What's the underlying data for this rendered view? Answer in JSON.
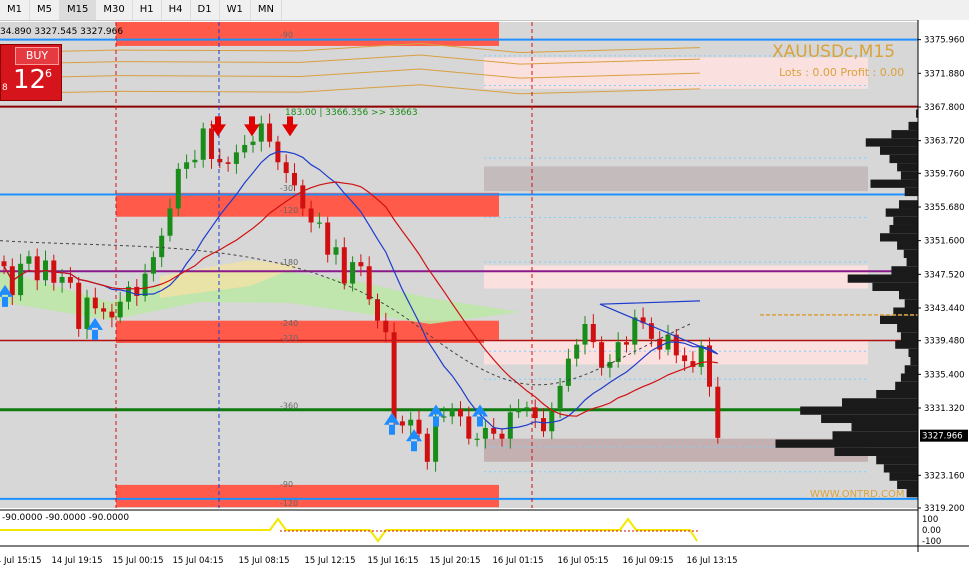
{
  "timeframes": [
    "M1",
    "M5",
    "M15",
    "M30",
    "H1",
    "H4",
    "D1",
    "W1",
    "MN"
  ],
  "selected_timeframe": "M15",
  "symbol_title": "XAUUSDc,M15",
  "lots_profit": "Lots : 0.00  Profit : 0.00",
  "watermark": "WWW.ONTRD.COM",
  "ohlc_line": "34.890 3327.545 3327.966",
  "buy_panel": {
    "label": "BUY",
    "price_small": "8",
    "price_big": "12",
    "price_sup": "6"
  },
  "indicator_values": "-90.0000 -90.0000 -90.0000",
  "level_label_183": "183.00 | 3366.356  >> 33663",
  "current_price_label": "3327.966",
  "colors": {
    "background": "#ffffff",
    "plot_bg": "#d7d7d7",
    "bull": "#1a8c1a",
    "bear": "#d01010",
    "zone_red": "#ff5a4a",
    "blue_line": "#1e90ff",
    "ma_blue": "#1e3ccc",
    "ma_red": "#d01010",
    "gold_text": "#dba23a",
    "profile": "#1a1a1a"
  },
  "chart_data": {
    "type": "candlestick",
    "symbol": "XAUUSDc",
    "timeframe": "M15",
    "ylim": [
      3319.2,
      3378.1
    ],
    "y_ticks": [
      "3375.960",
      "3371.880",
      "3367.800",
      "3363.720",
      "3359.760",
      "3355.680",
      "3351.600",
      "3347.520",
      "3343.440",
      "3339.480",
      "3335.400",
      "3331.320",
      "3327.966",
      "3323.160",
      "3319.200"
    ],
    "x_labels": [
      "14 Jul 15:15",
      "14 Jul 19:15",
      "15 Jul 00:15",
      "15 Jul 04:15",
      "15 Jul 08:15",
      "15 Jul 12:15",
      "15 Jul 16:15",
      "15 Jul 20:15",
      "16 Jul 01:15",
      "16 Jul 05:15",
      "16 Jul 09:15",
      "16 Jul 13:15"
    ],
    "level_labels": [
      "-90",
      "-30",
      "-120",
      "-180",
      "-240",
      "-270",
      "-360",
      "-90",
      "-120"
    ],
    "indicator_ticks": [
      "100",
      "0.00",
      "-100"
    ],
    "price_path": [
      3348.5,
      3345.0,
      3348.8,
      3349.7,
      3346.8,
      3349.2,
      3346.5,
      3347.2,
      3346.5,
      3340.9,
      3344.7,
      3343.4,
      3343.0,
      3342.3,
      3344.2,
      3346.0,
      3344.9,
      3347.6,
      3349.6,
      3352.2,
      3355.5,
      3360.3,
      3361.1,
      3361.4,
      3365.2,
      3361.5,
      3361.1,
      3360.9,
      3362.3,
      3363.2,
      3363.6,
      3365.8,
      3363.6,
      3361.1,
      3359.8,
      3358.3,
      3355.5,
      3353.8,
      3353.8,
      3349.9,
      3350.8,
      3346.4,
      3349.0,
      3348.5,
      3344.5,
      3341.9,
      3340.5,
      3329.7,
      3329.2,
      3329.9,
      3328.2,
      3324.8,
      3330.3,
      3330.3,
      3331.2,
      3330.3,
      3327.6,
      3327.6,
      3328.9,
      3328.2,
      3327.6,
      3330.8,
      3331.2,
      3331.4,
      3330.1,
      3328.5,
      3331.3,
      3334.0,
      3337.3,
      3339.0,
      3341.5,
      3339.3,
      3336.2,
      3336.9,
      3339.3,
      3339.0,
      3342.3,
      3341.6,
      3339.7,
      3338.4,
      3340.2,
      3337.7,
      3337.0,
      3336.3,
      3338.9,
      3333.9,
      3327.7
    ]
  }
}
